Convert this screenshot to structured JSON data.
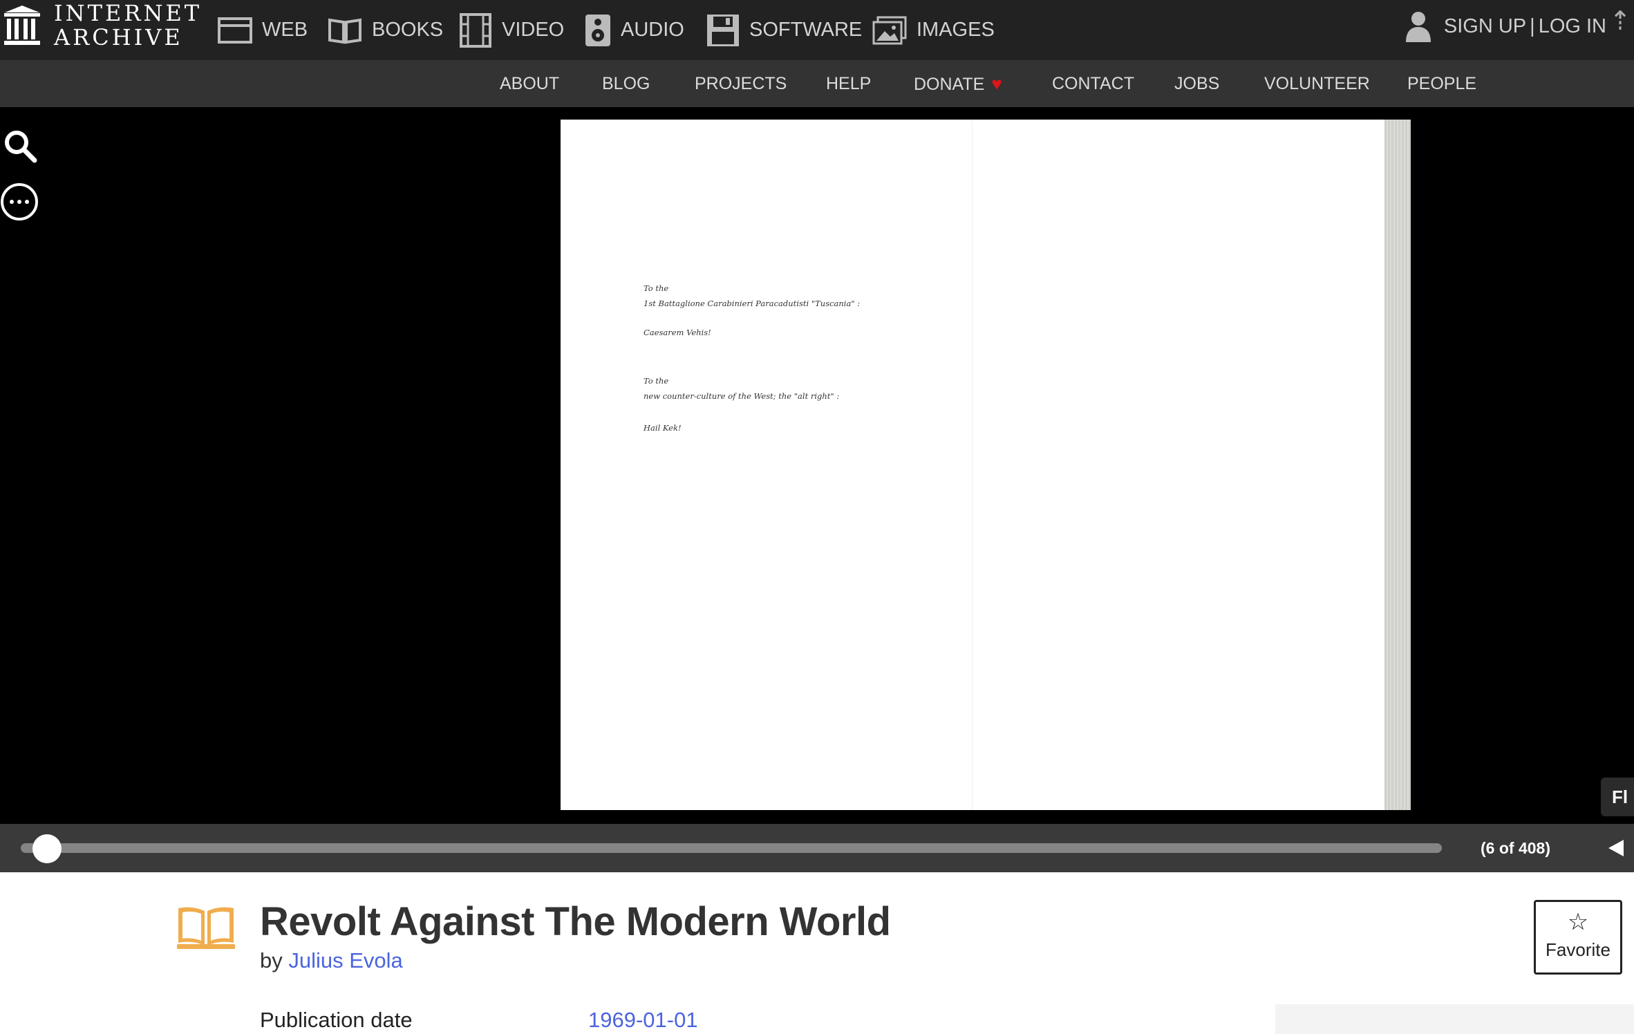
{
  "brand": {
    "line1": "INTERNET",
    "line2": "ARCHIVE"
  },
  "media_nav": [
    {
      "id": "web",
      "label": "WEB",
      "icon": "web-icon"
    },
    {
      "id": "books",
      "label": "BOOKS",
      "icon": "books-icon"
    },
    {
      "id": "video",
      "label": "VIDEO",
      "icon": "film-icon"
    },
    {
      "id": "audio",
      "label": "AUDIO",
      "icon": "speaker-icon"
    },
    {
      "id": "software",
      "label": "SOFTWARE",
      "icon": "floppy-disk-icon"
    },
    {
      "id": "images",
      "label": "IMAGES",
      "icon": "images-icon"
    }
  ],
  "auth": {
    "signup": "SIGN UP",
    "separator": "|",
    "login": "LOG IN",
    "icon": "user-icon"
  },
  "sub_nav": [
    {
      "label": "ABOUT"
    },
    {
      "label": "BLOG"
    },
    {
      "label": "PROJECTS"
    },
    {
      "label": "HELP"
    },
    {
      "label": "DONATE",
      "icon": "heart-icon"
    },
    {
      "label": "CONTACT"
    },
    {
      "label": "JOBS"
    },
    {
      "label": "VOLUNTEER"
    },
    {
      "label": "PEOPLE"
    }
  ],
  "reader": {
    "page_text": [
      "To the",
      "1st Battaglione Carabinieri Paracadutisti \"Tuscania\" :",
      "",
      "Caesarem Vehis!",
      "",
      "",
      "To the",
      "new counter-culture of the West; the \"alt right\" :",
      "",
      "Hail Kek!"
    ],
    "side_tab_label": "Fl",
    "current_page": 6,
    "total_pages": 408,
    "page_count_label": "(6 of 408)"
  },
  "item": {
    "title": "Revolt Against The Modern World",
    "by_label": "by",
    "author": "Julius Evola",
    "favorite_label": "Favorite",
    "metadata": [
      {
        "label": "Publication date",
        "value": "1969-01-01"
      }
    ]
  },
  "colors": {
    "accent": "#4b64de",
    "book_icon": "#f0ad4e",
    "heart": "#e0141b",
    "topbar": "#222222",
    "subnav": "#333333"
  }
}
